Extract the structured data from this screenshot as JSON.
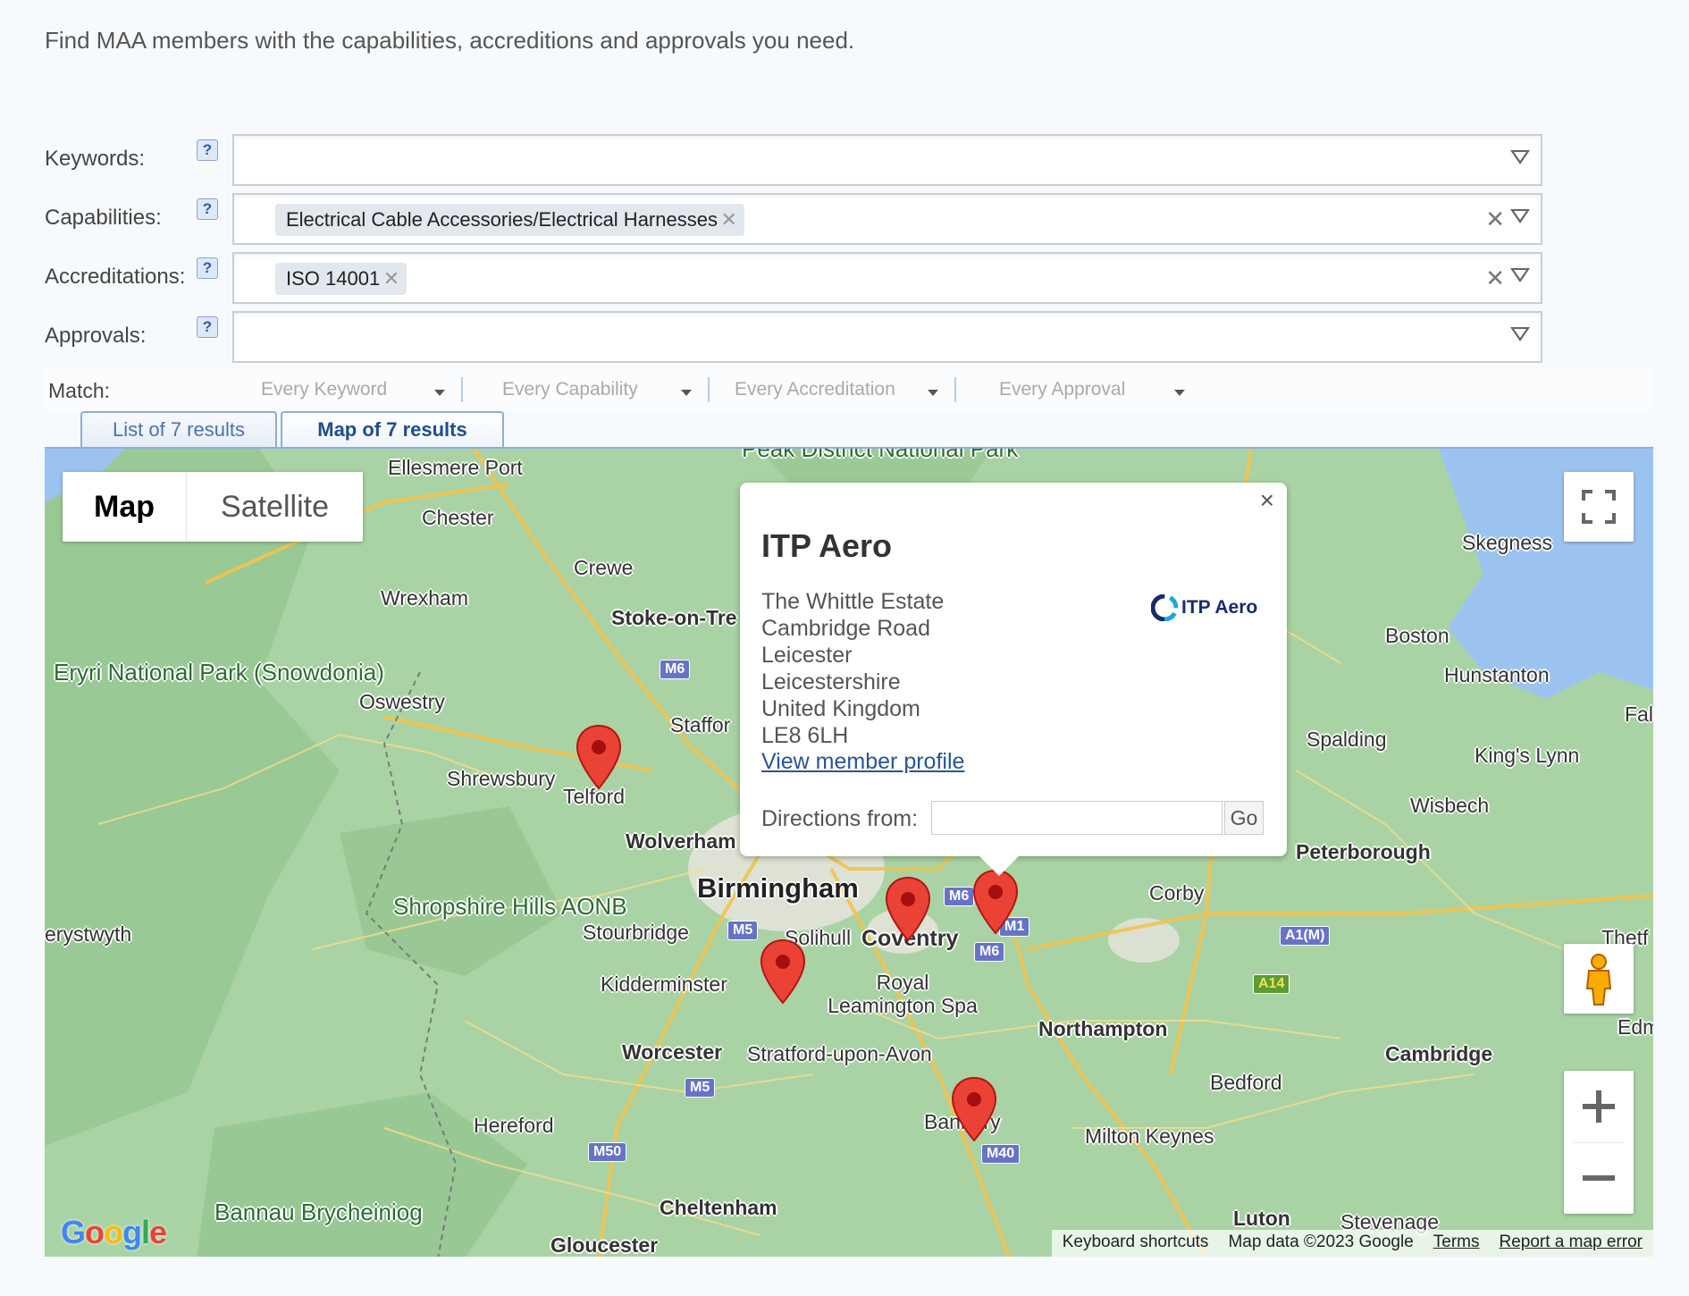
{
  "intro": "Find MAA members with the capabilities, accreditions and approvals you need.",
  "filters": [
    {
      "label": "Keywords:",
      "tags": []
    },
    {
      "label": "Capabilities:",
      "tags": [
        "Electrical Cable Accessories/Electrical Harnesses"
      ]
    },
    {
      "label": "Accreditations:",
      "tags": [
        "ISO 14001"
      ]
    },
    {
      "label": "Approvals:",
      "tags": []
    }
  ],
  "help_glyph": "?",
  "tag_remove_glyph": "✕",
  "clear_glyph": "✕",
  "match": {
    "label": "Match:",
    "selects": [
      "Every Keyword",
      "Every Capability",
      "Every Accreditation",
      "Every Approval"
    ]
  },
  "tabs": [
    {
      "label": "List of 7 results",
      "active": false
    },
    {
      "label": "Map of 7 results",
      "active": true
    }
  ],
  "map": {
    "type_options": [
      "Map",
      "Satellite"
    ],
    "selected_type": "Map",
    "places": [
      "Ellesmere Port",
      "Chester",
      "Crewe",
      "Wrexham",
      "Stoke-on-Tre",
      "Oswestry",
      "Staffor",
      "Shrewsbury",
      "Telford",
      "Wolverham",
      "Birmingham",
      "Stourbridge",
      "Solihull",
      "Coventry",
      "Kidderminster",
      "Royal Leamington Spa",
      "Worcester",
      "Stratford-upon-Avon",
      "Northampton",
      "Hereford",
      "Banbury",
      "Milton Keynes",
      "Bedford",
      "Cambridge",
      "Cheltenham",
      "Gloucester",
      "Luton",
      "Stevenage",
      "Corby",
      "Peterborough",
      "Wisbech",
      "King's Lynn",
      "Spalding",
      "Boston",
      "Hunstanton",
      "Skegness",
      "erystwyth",
      "Fal",
      "Thetf",
      "Edmun"
    ],
    "parks": [
      "Eryri National Park (Snowdonia)",
      "Shropshire Hills AONB",
      "Bannau Brycheiniog",
      "Peak District National Park"
    ],
    "roads": [
      "M6",
      "M6",
      "M6",
      "M1",
      "M5",
      "M5",
      "M50",
      "M40",
      "A1(M)",
      "A14"
    ],
    "pins": 5,
    "attribution": [
      "Keyboard shortcuts",
      "Map data ©2023 Google",
      "Terms",
      "Report a map error"
    ],
    "logo": "Google"
  },
  "infowindow": {
    "title": "ITP Aero",
    "address": [
      "The Whittle Estate",
      "Cambridge Road",
      "Leicester",
      "Leicestershire",
      "United Kingdom",
      "LE8 6LH"
    ],
    "profile_link": "View member profile",
    "directions_label": "Directions from:",
    "go_label": "Go",
    "logo_text": "ITP Aero",
    "close_glyph": "×"
  },
  "colors": {
    "accent": "#2a5592",
    "pin": "#ea4335",
    "map_land": "#a9d3a4",
    "water": "#9cc3f0"
  }
}
